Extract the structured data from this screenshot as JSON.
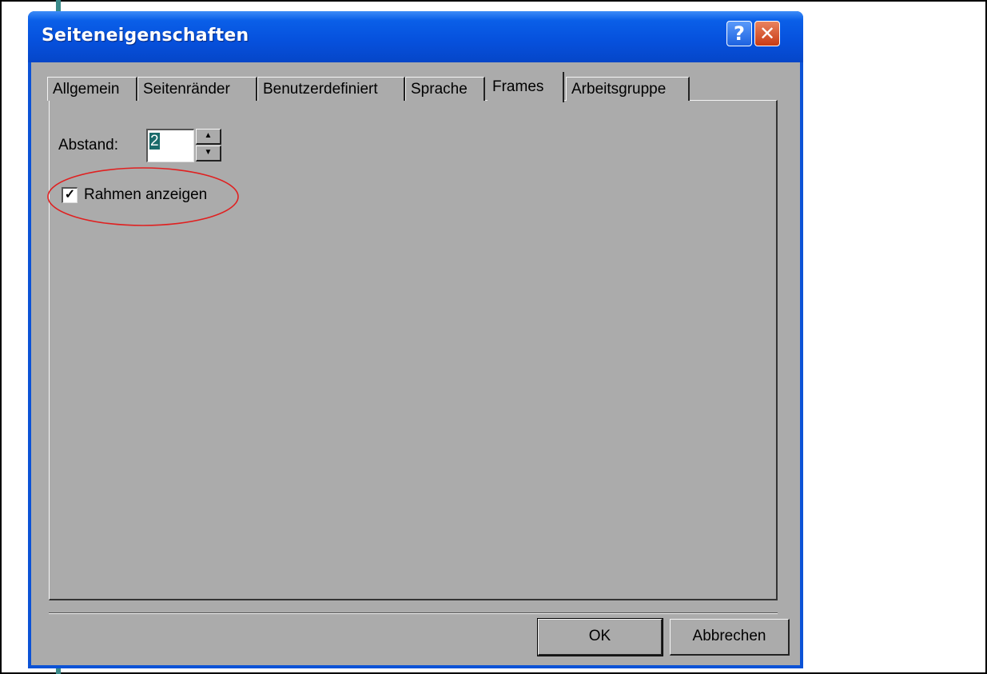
{
  "dialog": {
    "title": "Seiteneigenschaften",
    "help_button": "?",
    "close_button": "✕"
  },
  "tabs": [
    {
      "label": "Allgemein"
    },
    {
      "label": "Seitenränder"
    },
    {
      "label": "Benutzerdefiniert"
    },
    {
      "label": "Sprache"
    },
    {
      "label": "Frames",
      "active": true
    },
    {
      "label": "Arbeitsgruppe"
    }
  ],
  "frames_panel": {
    "abstand_label": "Abstand:",
    "abstand_value": "2",
    "rahmen_checkbox": {
      "label": "Rahmen anzeigen",
      "checked": true
    }
  },
  "buttons": {
    "ok": "OK",
    "cancel": "Abbrechen"
  },
  "colors": {
    "titlebar": "#0650dc",
    "client_bg": "#ababab",
    "annotation": "#e02020"
  }
}
